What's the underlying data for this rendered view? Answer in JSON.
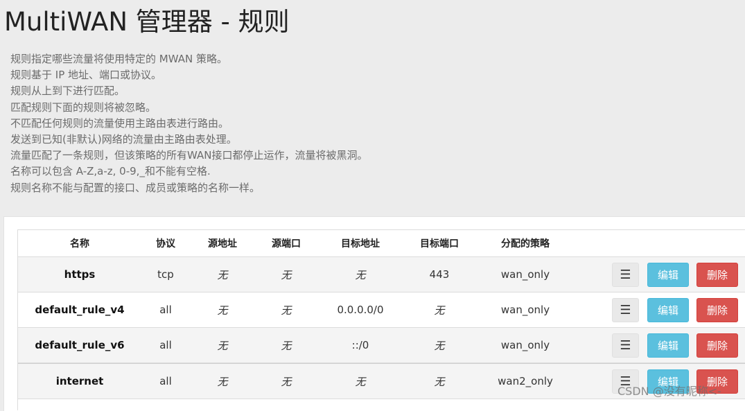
{
  "page": {
    "title": "MultiWAN 管理器 - 规则",
    "description": [
      "规则指定哪些流量将使用特定的 MWAN 策略。",
      "规则基于 IP 地址、端口或协议。",
      "规则从上到下进行匹配。",
      "匹配规则下面的规则将被忽略。",
      "不匹配任何规则的流量使用主路由表进行路由。",
      "发送到已知(非默认)网络的流量由主路由表处理。",
      "流量匹配了一条规则，但该策略的所有WAN接口都停止运作，流量将被黑洞。",
      "名称可以包含 A-Z,a-z, 0-9,_和不能有空格.",
      "规则名称不能与配置的接口、成员或策略的名称一样。"
    ]
  },
  "table": {
    "headers": {
      "name": "名称",
      "protocol": "协议",
      "src_ip": "源地址",
      "src_port": "源端口",
      "dest_ip": "目标地址",
      "dest_port": "目标端口",
      "policy": "分配的策略"
    },
    "rows": [
      {
        "name": "https",
        "protocol": "tcp",
        "src_ip": "无",
        "src_port": "无",
        "dest_ip": "无",
        "dest_port": "443",
        "policy": "wan_only"
      },
      {
        "name": "default_rule_v4",
        "protocol": "all",
        "src_ip": "无",
        "src_port": "无",
        "dest_ip": "0.0.0.0/0",
        "dest_port": "无",
        "policy": "wan_only"
      },
      {
        "name": "default_rule_v6",
        "protocol": "all",
        "src_ip": "无",
        "src_port": "无",
        "dest_ip": "::/0",
        "dest_port": "无",
        "policy": "wan_only"
      },
      {
        "name": "internet",
        "protocol": "all",
        "src_ip": "无",
        "src_port": "无",
        "dest_ip": "无",
        "dest_port": "无",
        "policy": "wan2_only"
      }
    ]
  },
  "actions": {
    "sort_icon": "☰",
    "edit_label": "编辑",
    "delete_label": "删除"
  },
  "watermark": "CSDN @没有昵称<-",
  "colors": {
    "edit_button": "#5bc0de",
    "delete_button": "#d9534f",
    "sort_button": "#e9e9e9",
    "page_background": "#ececec"
  }
}
